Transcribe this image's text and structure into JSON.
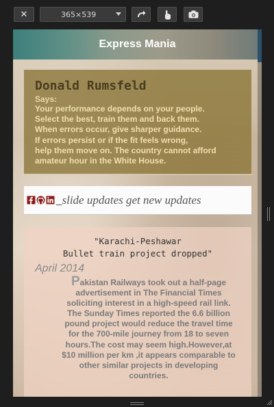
{
  "toolbar": {
    "close_icon": "close-icon",
    "device_size": "365×539",
    "rotate_icon": "rotate-icon",
    "touch_icon": "touch-icon",
    "screenshot_icon": "camera-icon"
  },
  "app": {
    "title": "Express Mania",
    "accent": "#3d7f7b"
  },
  "quote": {
    "author": "Donald Rumsfeld",
    "says": "Says:",
    "text": "Your performance depends on your people.\nSelect the best, train them and back them.\nWhen errors occur, give sharper guidance.\nIf errors persist or if the fit feels wrong,\nhelp them move on. The country cannot afford\namateur hour in the White House."
  },
  "updates": {
    "icons": [
      "facebook-icon",
      "github-icon",
      "linkedin-icon"
    ],
    "underlined_part": "_",
    "text": "slide updates get new updates"
  },
  "news": {
    "headline": "\"Karachi-Peshawar\nBullet train project dropped\"",
    "date": "April 2014",
    "dropcap": "P",
    "body": "akistan Railways took out a half-page advertisement in The Financial Times soliciting interest in a high-speed rail link. The Sunday Times reported the 6.6 billion pound project would reduce the travel time for the 700-mile journey from 18 to seven hours.The cost may seem high.However,at $10 million per km ,it appears comparable to other similar projects in developing countries."
  }
}
